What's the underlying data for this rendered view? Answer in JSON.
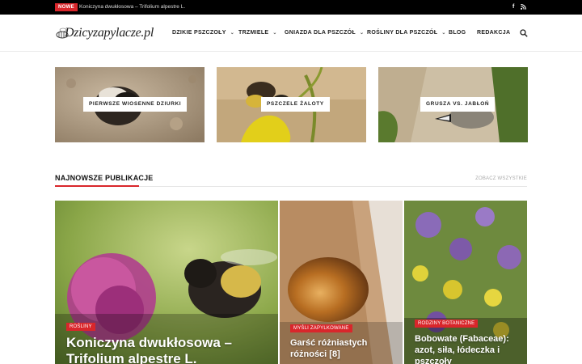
{
  "topbar": {
    "badge": "NOWE",
    "ticker": "Koniczyna dwukłosowa – Trifolium alpestre L.",
    "social": [
      "facebook-icon",
      "rss-icon"
    ]
  },
  "header": {
    "logo": "Dzicyzapylacze.pl",
    "nav": [
      "DZIKIE PSZCZOŁY",
      "TRZMIELE",
      "GNIAZDA DLA PSZCZÓŁ",
      "ROŚLINY DLA PSZCZÓŁ",
      "BLOG",
      "REDAKCJA"
    ]
  },
  "featured": [
    {
      "label": "PIERWSZE WIOSENNE DZIURKI"
    },
    {
      "label": "PSZCZELE ŻALOTY"
    },
    {
      "label": "GRUSZA VS. JABŁOŃ"
    }
  ],
  "section": {
    "title": "NAJNOWSZE PUBLIKACJE",
    "see_all": "ZOBACZ WSZYSTKIE"
  },
  "posts": [
    {
      "category": "ROŚLINY",
      "title_line1": "Koniczyna dwukłosowa –",
      "title_line2": "Trifolium alpestre L."
    },
    {
      "category": "MYŚLI ZAPYLKOWANE",
      "title_line1": "Garść różniastych",
      "title_line2": "różności [8]"
    },
    {
      "category": "RODZINY BOTANICZNE",
      "title_line1": "Bobowate (Fabaceae):",
      "title_line2": "azot, siła, łódeczka i",
      "title_line3": "pszczoły"
    }
  ],
  "colors": {
    "accent": "#d9262b",
    "topbar": "#000000"
  }
}
